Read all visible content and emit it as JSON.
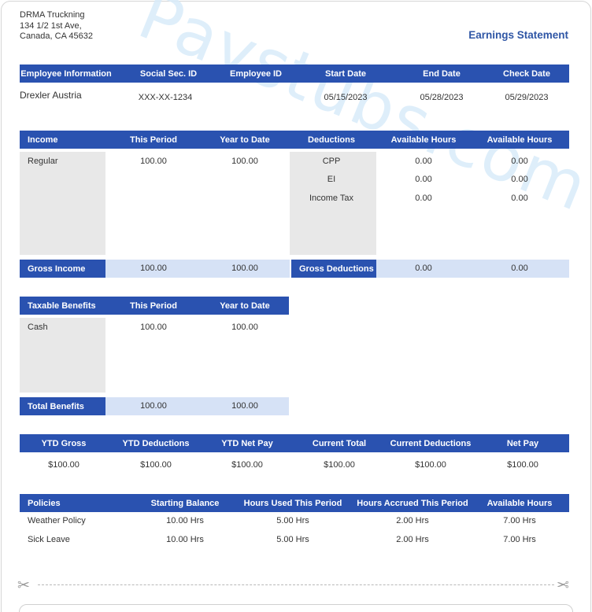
{
  "watermark": "Paystubs.com",
  "company": {
    "name": "DRMA Truckning",
    "address1": "134 1/2 1st Ave,",
    "address2": "Canada, CA 45632"
  },
  "statement_title": "Earnings Statement",
  "employee_header": [
    "Employee Information",
    "Social Sec. ID",
    "Employee ID",
    "Start Date",
    "End Date",
    "Check Date"
  ],
  "employee": {
    "name": "Drexler Austria",
    "ssn": "XXX-XX-1234",
    "employee_id": "",
    "start_date": "05/15/2023",
    "end_date": "05/28/2023",
    "check_date": "05/29/2023"
  },
  "income_header": [
    "Income",
    "This Period",
    "Year to Date",
    "Deductions",
    "Available Hours",
    "Available Hours"
  ],
  "income_rows": [
    {
      "label": "Regular",
      "period": "100.00",
      "ytd": "100.00"
    }
  ],
  "deduction_rows": [
    {
      "label": "CPP",
      "col1": "0.00",
      "col2": "0.00"
    },
    {
      "label": "EI",
      "col1": "0.00",
      "col2": "0.00"
    },
    {
      "label": "Income Tax",
      "col1": "0.00",
      "col2": "0.00"
    }
  ],
  "gross_income": {
    "label": "Gross Income",
    "period": "100.00",
    "ytd": "100.00"
  },
  "gross_deductions": {
    "label": "Gross Deductions",
    "col1": "0.00",
    "col2": "0.00"
  },
  "benefits_header": [
    "Taxable Benefits",
    "This Period",
    "Year to Date"
  ],
  "benefit_rows": [
    {
      "label": "Cash",
      "period": "100.00",
      "ytd": "100.00"
    }
  ],
  "total_benefits": {
    "label": "Total Benefits",
    "period": "100.00",
    "ytd": "100.00"
  },
  "summary_header": [
    "YTD Gross",
    "YTD Deductions",
    "YTD Net Pay",
    "Current Total",
    "Current Deductions",
    "Net Pay"
  ],
  "summary_values": [
    "$100.00",
    "$100.00",
    "$100.00",
    "$100.00",
    "$100.00",
    "$100.00"
  ],
  "policies_header": [
    "Policies",
    "Starting Balance",
    "Hours Used This Period",
    "Hours Accrued This Period",
    "Available Hours"
  ],
  "policies": [
    {
      "name": "Weather Policy",
      "start": "10.00 Hrs",
      "used": "5.00 Hrs",
      "accrued": "2.00 Hrs",
      "available": "7.00 Hrs"
    },
    {
      "name": "Sick Leave",
      "start": "10.00 Hrs",
      "used": "5.00 Hrs",
      "accrued": "2.00 Hrs",
      "available": "7.00 Hrs"
    }
  ],
  "icons": {
    "cut_left": "scissors-icon",
    "cut_right": "scissors-icon"
  },
  "colors": {
    "header_blue": "#2a52b0",
    "title_blue": "#2f56a5",
    "band_light": "#d6e2f6",
    "gray_cell": "#e8e8e8"
  }
}
